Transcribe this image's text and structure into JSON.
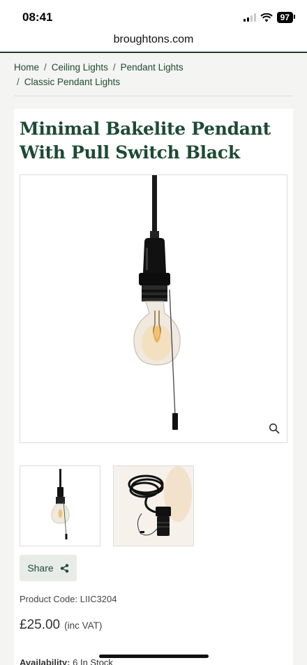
{
  "status_bar": {
    "time": "08:41",
    "battery": "97"
  },
  "browser": {
    "url": "broughtons.com"
  },
  "breadcrumb": {
    "items": [
      "Home",
      "Ceiling Lights",
      "Pendant Lights",
      "Classic Pendant Lights"
    ],
    "separator": "/"
  },
  "product": {
    "title_line1": "Minimal Bakelite Pendant",
    "title_line2": "With Pull Switch Black",
    "share_label": "Share",
    "code_label": "Product Code:",
    "code": "LIIC3204",
    "price": "£25.00",
    "vat_note": "(inc VAT)",
    "availability_label": "Availability:",
    "availability_value": "6 In Stock"
  },
  "colors": {
    "brand_green": "#1d4a35",
    "share_bg": "#e8ece9"
  },
  "icons": {
    "zoom": "magnifier-icon",
    "share": "share-icon"
  }
}
